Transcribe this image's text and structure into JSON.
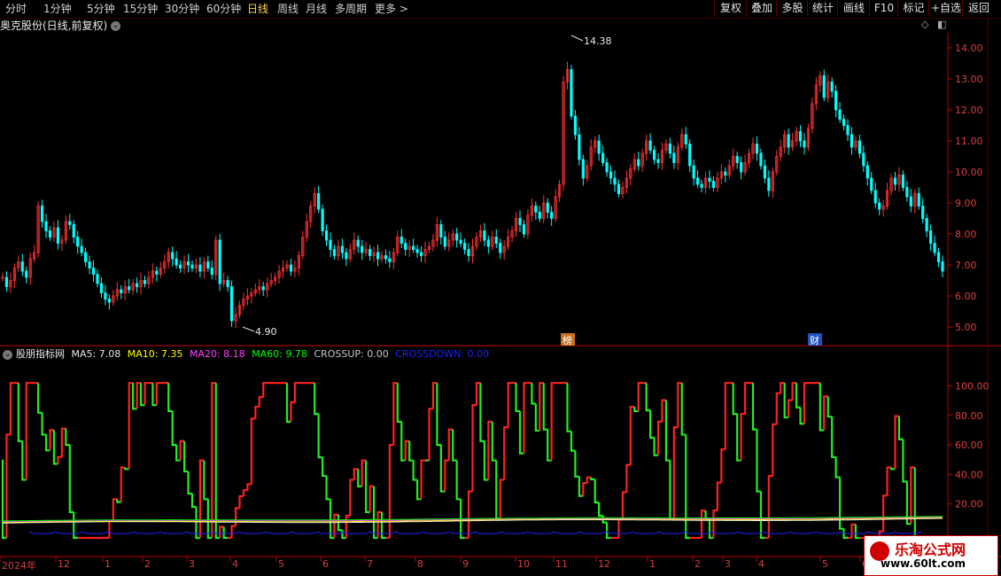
{
  "toolbar": {
    "periods": [
      "分时",
      "1分钟",
      "5分钟",
      "15分钟",
      "30分钟",
      "60分钟",
      "日线",
      "周线",
      "月线",
      "多周期",
      "更多"
    ],
    "active_period": "日线",
    "more_arrow": ">",
    "right_buttons": [
      "复权",
      "叠加",
      "多股",
      "统计",
      "画线",
      "F10",
      "标记",
      "+自选",
      "返回"
    ]
  },
  "chart_title": "奥克股份(日线,前复权)",
  "price_axis": [
    "14.00",
    "13.00",
    "12.00",
    "11.00",
    "10.00",
    "9.00",
    "8.00",
    "7.00",
    "6.00",
    "5.00"
  ],
  "price_high_label": "14.38",
  "price_low_label": "4.90",
  "badges": {
    "bang": "榜",
    "cai": "财"
  },
  "indicator": {
    "name": "股朋指标网",
    "ma5": "MA5: 7.08",
    "ma10": "MA10: 7.35",
    "ma20": "MA20: 8.18",
    "ma60": "MA60: 9.78",
    "crossup": "CROSSUP: 0.00",
    "crossdown": "CROSSDOWN: 0.00",
    "axis": [
      "100.00",
      "80.00",
      "60.00",
      "40.00",
      "20.00"
    ],
    "colors": {
      "ma5": "#e8e8e8",
      "ma10": "#ffff00",
      "ma20": "#ff40ff",
      "ma60": "#00ff00",
      "crossup": "#c8c8c8",
      "crossdown": "#2020ff"
    }
  },
  "date_axis": [
    "2024年",
    "12",
    "1",
    "2",
    "3",
    "4",
    "5",
    "6",
    "7",
    "8",
    "9",
    "10",
    "11",
    "12",
    "1",
    "2",
    "3",
    "4",
    "5",
    "6"
  ],
  "watermark": {
    "line1": "乐淘公式网",
    "line2": "www.60lt.com"
  },
  "colors": {
    "up": "#ff3030",
    "down": "#00ffff",
    "osc_up": "#ff2020",
    "osc_down": "#22ee22",
    "axis": "#c00000"
  },
  "chart_data": {
    "type": "candlestick",
    "price_ylim": [
      4.6,
      14.6
    ],
    "closes": [
      6.6,
      6.3,
      6.5,
      6.9,
      7.1,
      6.8,
      6.6,
      7.2,
      7.4,
      8.9,
      8.4,
      8.1,
      7.9,
      8.2,
      7.7,
      7.8,
      8.4,
      8.3,
      7.9,
      7.6,
      7.4,
      7.1,
      6.9,
      6.7,
      6.4,
      6.1,
      5.9,
      5.8,
      6.0,
      6.2,
      6.1,
      6.3,
      6.2,
      6.4,
      6.3,
      6.5,
      6.4,
      6.6,
      6.8,
      6.7,
      6.9,
      7.1,
      7.4,
      7.2,
      7.0,
      6.9,
      7.1,
      7.0,
      6.9,
      7.0,
      6.8,
      7.1,
      6.9,
      6.7,
      7.8,
      6.4,
      6.5,
      6.3,
      5.2,
      5.4,
      5.7,
      5.9,
      6.0,
      6.1,
      6.2,
      6.3,
      6.2,
      6.4,
      6.5,
      6.6,
      6.8,
      6.9,
      7.0,
      6.8,
      6.9,
      7.3,
      7.9,
      8.4,
      8.9,
      9.3,
      8.8,
      8.1,
      7.8,
      7.5,
      7.3,
      7.6,
      7.4,
      7.2,
      7.5,
      7.8,
      7.6,
      7.4,
      7.5,
      7.3,
      7.4,
      7.2,
      7.3,
      7.2,
      7.1,
      7.4,
      7.9,
      7.7,
      7.5,
      7.6,
      7.5,
      7.4,
      7.3,
      7.5,
      7.6,
      7.8,
      8.3,
      7.9,
      7.6,
      7.8,
      8.0,
      7.8,
      7.7,
      7.5,
      7.3,
      7.6,
      7.9,
      8.1,
      7.8,
      7.6,
      7.9,
      7.7,
      7.4,
      7.6,
      7.9,
      8.1,
      8.5,
      8.3,
      8.0,
      8.6,
      8.9,
      8.7,
      8.5,
      9.0,
      8.7,
      8.5,
      9.2,
      9.6,
      12.9,
      13.3,
      11.8,
      11.2,
      10.4,
      9.8,
      10.2,
      10.8,
      11.0,
      10.6,
      10.3,
      10.0,
      9.8,
      9.6,
      9.3,
      9.5,
      9.8,
      10.1,
      10.4,
      10.2,
      10.6,
      11.0,
      10.7,
      10.4,
      10.3,
      10.7,
      10.9,
      10.6,
      10.3,
      10.8,
      11.2,
      10.9,
      10.2,
      9.8,
      9.6,
      9.5,
      9.8,
      9.7,
      9.5,
      9.8,
      10.0,
      9.9,
      10.2,
      10.5,
      10.3,
      10.0,
      10.3,
      10.6,
      10.9,
      10.6,
      10.2,
      9.8,
      9.4,
      10.0,
      10.5,
      10.8,
      11.2,
      10.8,
      11.0,
      11.3,
      11.0,
      10.8,
      11.4,
      12.2,
      12.8,
      13.1,
      12.4,
      12.9,
      12.6,
      12.0,
      11.7,
      11.5,
      11.2,
      10.8,
      11.0,
      10.6,
      10.2,
      9.8,
      9.4,
      9.0,
      8.8,
      8.9,
      9.4,
      9.8,
      9.6,
      9.9,
      9.5,
      9.2,
      8.9,
      9.3,
      8.9,
      8.5,
      8.1,
      7.7,
      7.4,
      7.1,
      6.8
    ]
  }
}
